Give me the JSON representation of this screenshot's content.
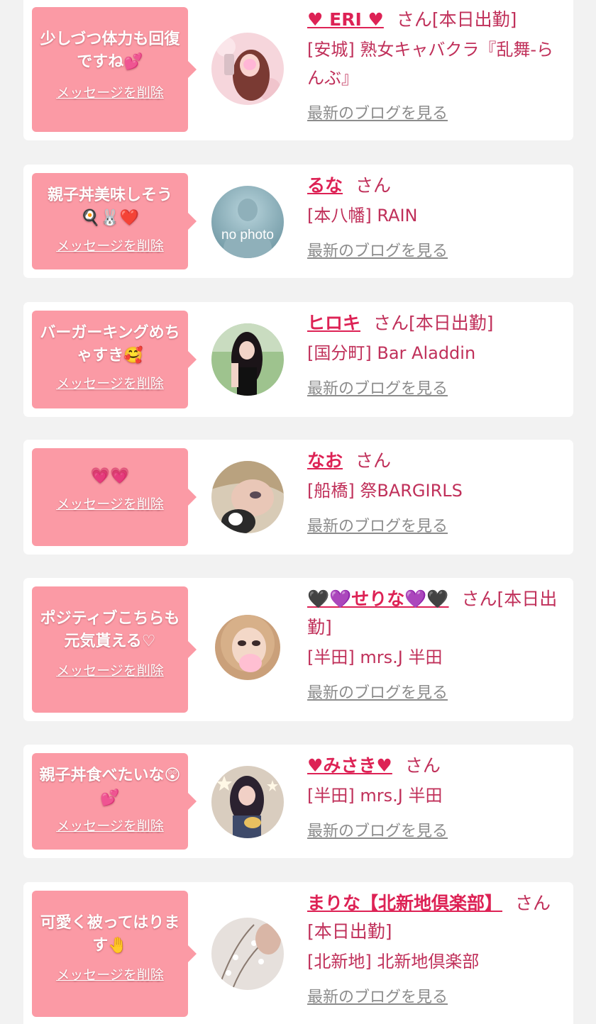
{
  "cards": [
    {
      "message": "少しづつ体力も回復ですね💕",
      "delete_label": "メッセージを削除",
      "name": "♥ ERI ♥",
      "suffix": "さん[本日出勤]",
      "shop": "[安城] 熟女キャバクラ『乱舞-らんぶ』",
      "blog_label": "最新のブログを見る"
    },
    {
      "message": "親子丼美味しそう🍳🐰❤️",
      "delete_label": "メッセージを削除",
      "name": "るな",
      "suffix": "さん",
      "shop": "[本八幡] RAIN",
      "blog_label": "最新のブログを見る",
      "avatar_text": "no photo"
    },
    {
      "message": "バーガーキングめちゃすき🥰",
      "delete_label": "メッセージを削除",
      "name": "ヒロキ",
      "suffix": "さん[本日出勤]",
      "shop": "[国分町] Bar Aladdin",
      "blog_label": "最新のブログを見る"
    },
    {
      "message": "💗💗",
      "delete_label": "メッセージを削除",
      "name": "なお",
      "suffix": "さん",
      "shop": "[船橋] 祭BARGIRLS",
      "blog_label": "最新のブログを見る"
    },
    {
      "message": "ポジティブこちらも元気貰える♡",
      "delete_label": "メッセージを削除",
      "name": "🖤💜せりな💜🖤",
      "suffix": "さん[本日出勤]",
      "shop": "[半田] mrs.J 半田",
      "blog_label": "最新のブログを見る"
    },
    {
      "message": "親子丼食べたいな😲💕",
      "delete_label": "メッセージを削除",
      "name": "♥みさき♥",
      "suffix": "さん",
      "shop": "[半田] mrs.J 半田",
      "blog_label": "最新のブログを見る"
    },
    {
      "message": "可愛く被ってはります🤚",
      "delete_label": "メッセージを削除",
      "name": "まりな【北新地倶楽部】",
      "suffix": "さん[本日出勤]",
      "shop": "[北新地] 北新地倶楽部",
      "blog_label": "最新のブログを見る"
    }
  ],
  "colors": {
    "page_background": "#f2f2f2",
    "card_background": "#ffffff",
    "bubble_pink": "#fb9aa5",
    "name_pink": "#dd2255",
    "shop_text": "#c0305a",
    "blog_link_gray": "#8c8c8c"
  }
}
